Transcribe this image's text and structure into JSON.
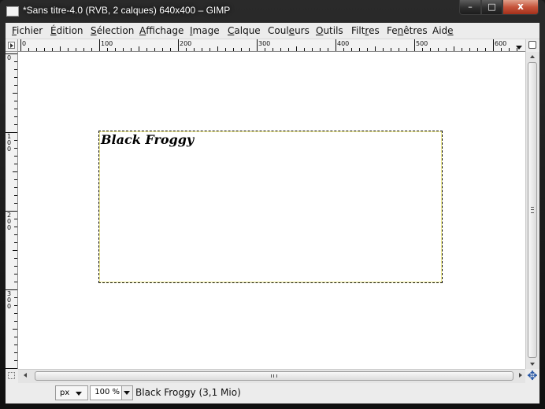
{
  "window": {
    "title": "*Sans titre-4.0 (RVB, 2 calques) 640x400 – GIMP",
    "controls": {
      "minimize": "–",
      "maximize": "□",
      "close": "x"
    }
  },
  "menu": [
    {
      "pre": "",
      "u": "F",
      "post": "ichier"
    },
    {
      "pre": "",
      "u": "É",
      "post": "dition"
    },
    {
      "pre": "",
      "u": "S",
      "post": "élection"
    },
    {
      "pre": "",
      "u": "A",
      "post": "ffichage"
    },
    {
      "pre": "",
      "u": "I",
      "post": "mage"
    },
    {
      "pre": "",
      "u": "C",
      "post": "alque"
    },
    {
      "pre": "Coul",
      "u": "e",
      "post": "urs"
    },
    {
      "pre": "",
      "u": "O",
      "post": "utils"
    },
    {
      "pre": "Filt",
      "u": "r",
      "post": "es"
    },
    {
      "pre": "Fe",
      "u": "n",
      "post": "êtres"
    },
    {
      "pre": "Aid",
      "u": "e",
      "post": ""
    }
  ],
  "rulers": {
    "horizontal_labels": [
      "0",
      "100",
      "200",
      "300",
      "400",
      "500",
      "600"
    ],
    "vertical_labels": [
      "0",
      "100",
      "200",
      "300"
    ]
  },
  "canvas": {
    "text_layer": "Black Froggy"
  },
  "statusbar": {
    "unit": "px",
    "zoom": "100 %",
    "message": "Black Froggy (3,1 Mio)"
  }
}
